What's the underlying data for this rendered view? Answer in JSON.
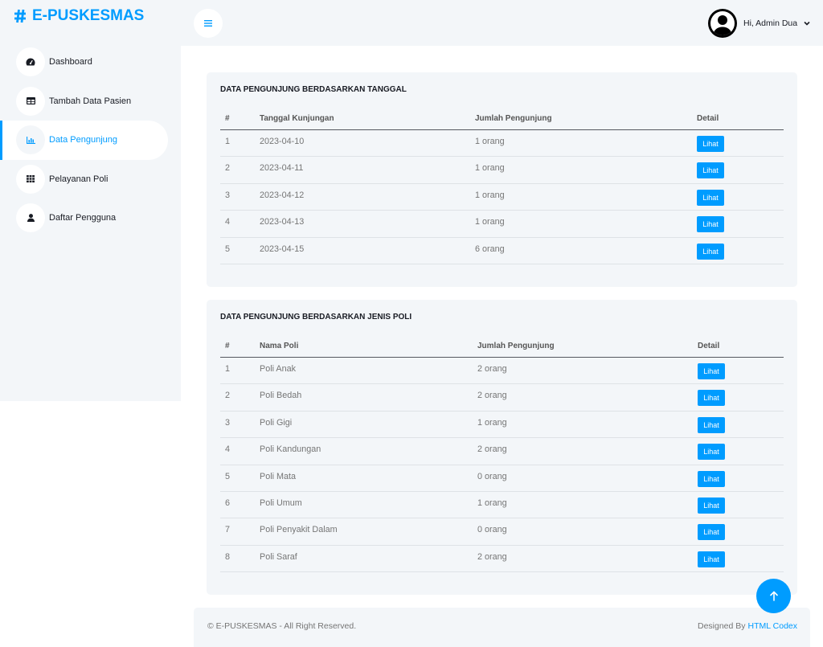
{
  "brand": {
    "name": "E-PUSKESMAS",
    "icon": "hashtag-icon"
  },
  "sidebar": {
    "items": [
      {
        "label": "Dashboard",
        "icon": "tachometer-icon",
        "active": false
      },
      {
        "label": "Tambah Data Pasien",
        "icon": "table-icon",
        "active": false
      },
      {
        "label": "Data Pengunjung",
        "icon": "chart-bar-icon",
        "active": true
      },
      {
        "label": "Pelayanan Poli",
        "icon": "grid-icon",
        "active": false
      },
      {
        "label": "Daftar Pengguna",
        "icon": "user-icon",
        "active": false
      }
    ]
  },
  "navbar": {
    "toggle_icon": "bars-icon",
    "avatar_icon": "user-avatar-icon",
    "greeting": "Hi, Admin Dua",
    "dropdown_icon": "chevron-down-icon"
  },
  "visits_by_date": {
    "title": "DATA PENGUNJUNG BERDASARKAN TANGGAL",
    "columns": [
      "#",
      "Tanggal Kunjungan",
      "Jumlah Pengunjung",
      "Detail"
    ],
    "rows": [
      {
        "no": "1",
        "date": "2023-04-10",
        "count": "1 orang",
        "action": "Lihat"
      },
      {
        "no": "2",
        "date": "2023-04-11",
        "count": "1 orang",
        "action": "Lihat"
      },
      {
        "no": "3",
        "date": "2023-04-12",
        "count": "1 orang",
        "action": "Lihat"
      },
      {
        "no": "4",
        "date": "2023-04-13",
        "count": "1 orang",
        "action": "Lihat"
      },
      {
        "no": "5",
        "date": "2023-04-15",
        "count": "6 orang",
        "action": "Lihat"
      }
    ]
  },
  "visits_by_poli": {
    "title": "DATA PENGUNJUNG BERDASARKAN JENIS POLI",
    "columns": [
      "#",
      "Nama Poli",
      "Jumlah Pengunjung",
      "Detail"
    ],
    "rows": [
      {
        "no": "1",
        "poli": "Poli Anak",
        "count": "2 orang",
        "action": "Lihat"
      },
      {
        "no": "2",
        "poli": "Poli Bedah",
        "count": "2 orang",
        "action": "Lihat"
      },
      {
        "no": "3",
        "poli": "Poli Gigi",
        "count": "1 orang",
        "action": "Lihat"
      },
      {
        "no": "4",
        "poli": "Poli Kandungan",
        "count": "2 orang",
        "action": "Lihat"
      },
      {
        "no": "5",
        "poli": "Poli Mata",
        "count": "0 orang",
        "action": "Lihat"
      },
      {
        "no": "6",
        "poli": "Poli Umum",
        "count": "1 orang",
        "action": "Lihat"
      },
      {
        "no": "7",
        "poli": "Poli Penyakit Dalam",
        "count": "0 orang",
        "action": "Lihat"
      },
      {
        "no": "8",
        "poli": "Poli Saraf",
        "count": "2 orang",
        "action": "Lihat"
      }
    ]
  },
  "footer": {
    "copyright": "© E-PUSKESMAS - All Right Reserved.",
    "designed_by": "Designed By",
    "designer": "HTML Codex"
  },
  "back_to_top": {
    "icon": "arrow-up-icon"
  },
  "colors": {
    "primary": "#009CFF",
    "light": "#F3F6F9",
    "dark": "#191C24",
    "muted_text": "#757575"
  }
}
